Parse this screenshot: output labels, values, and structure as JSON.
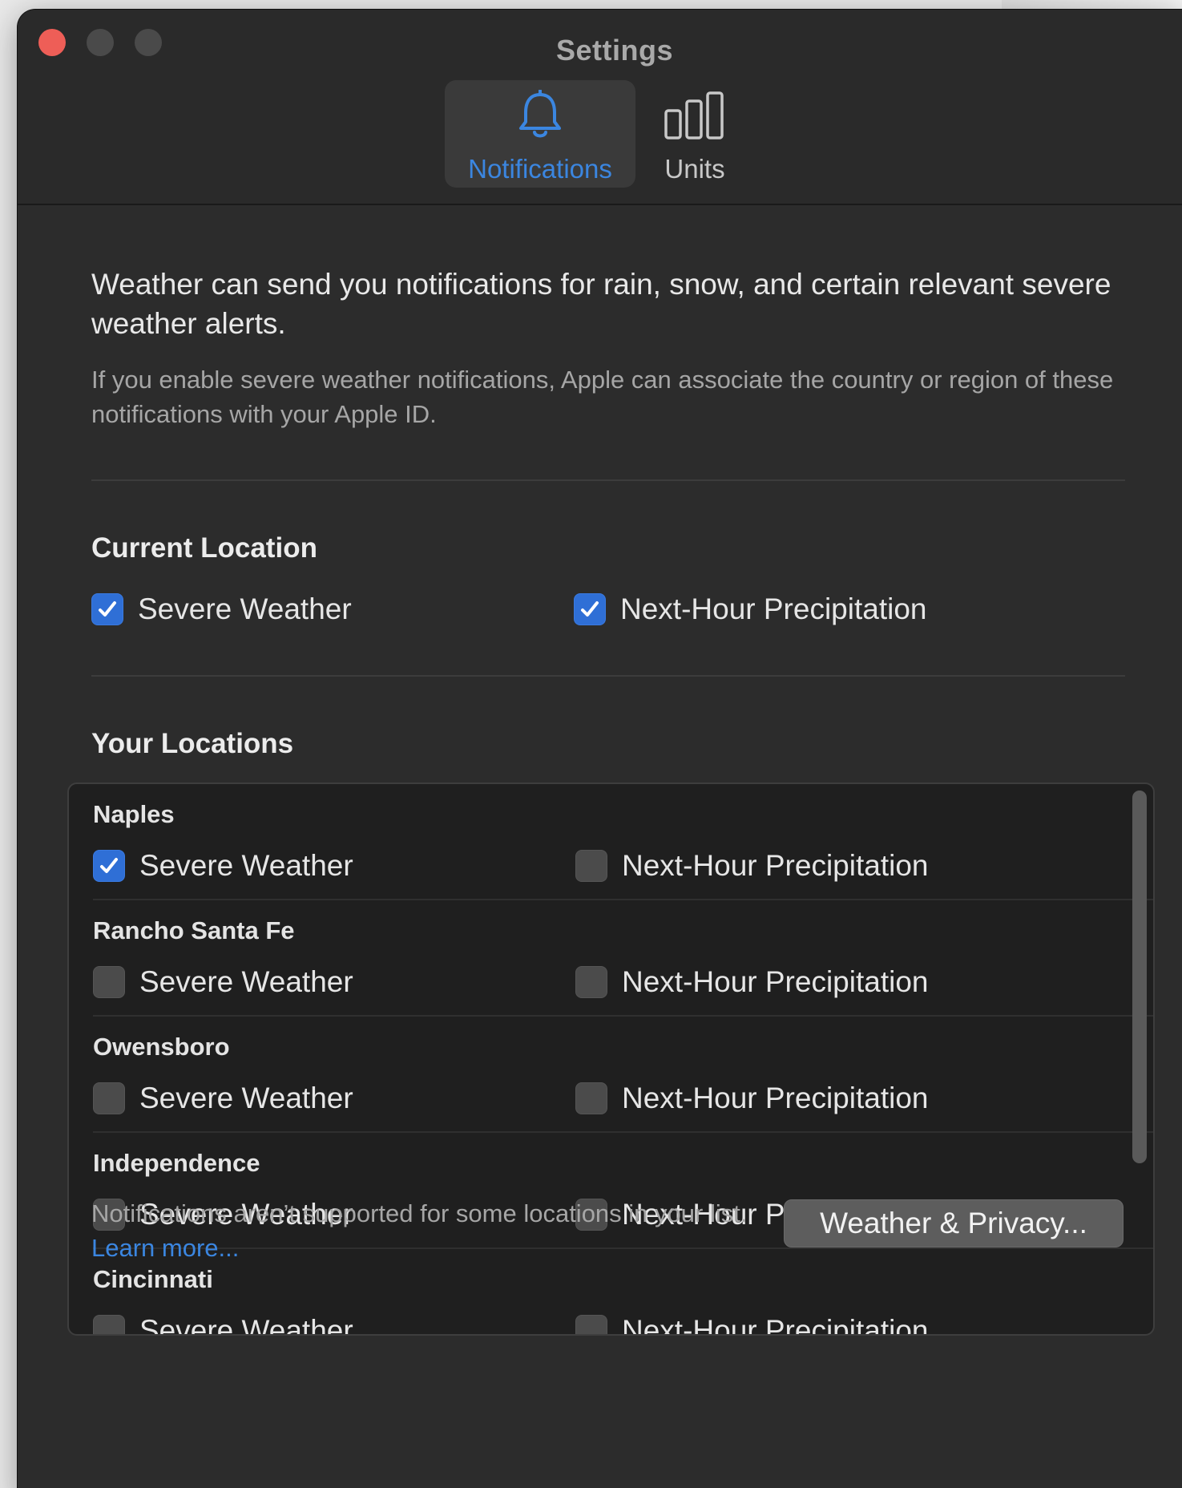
{
  "window": {
    "title": "Settings"
  },
  "toolbar": {
    "tabs": [
      {
        "label": "Notifications",
        "icon": "bell-icon",
        "selected": true
      },
      {
        "label": "Units",
        "icon": "units-bars-icon",
        "selected": false
      }
    ]
  },
  "intro": {
    "text": "Weather can send you notifications for rain, snow, and certain relevant severe weather alerts.",
    "subtext": "If you enable severe weather notifications, Apple can associate the country or region of these notifications with your Apple ID."
  },
  "current_location": {
    "title": "Current Location",
    "severe_label": "Severe Weather",
    "severe_checked": true,
    "precip_label": "Next-Hour Precipitation",
    "precip_checked": true
  },
  "your_locations": {
    "title": "Your Locations",
    "items": [
      {
        "name": "Naples",
        "severe_label": "Severe Weather",
        "severe_checked": true,
        "precip_label": "Next-Hour Precipitation",
        "precip_checked": false
      },
      {
        "name": "Rancho Santa Fe",
        "severe_label": "Severe Weather",
        "severe_checked": false,
        "precip_label": "Next-Hour Precipitation",
        "precip_checked": false
      },
      {
        "name": "Owensboro",
        "severe_label": "Severe Weather",
        "severe_checked": false,
        "precip_label": "Next-Hour Precipitation",
        "precip_checked": false
      },
      {
        "name": "Independence",
        "severe_label": "Severe Weather",
        "severe_checked": false,
        "precip_label": "Next-Hour Precipitation",
        "precip_checked": false
      },
      {
        "name": "Cincinnati",
        "severe_label": "Severe Weather",
        "severe_checked": false,
        "precip_label": "Next-Hour Precipitation",
        "precip_checked": false
      }
    ]
  },
  "footer": {
    "text": "Notifications aren’t supported for some locations in your list.",
    "link": "Learn more...",
    "button": "Weather & Privacy..."
  },
  "colors": {
    "accent": "#3b86e0",
    "checkbox_on": "#2f6fd6",
    "close": "#ee5e57"
  }
}
